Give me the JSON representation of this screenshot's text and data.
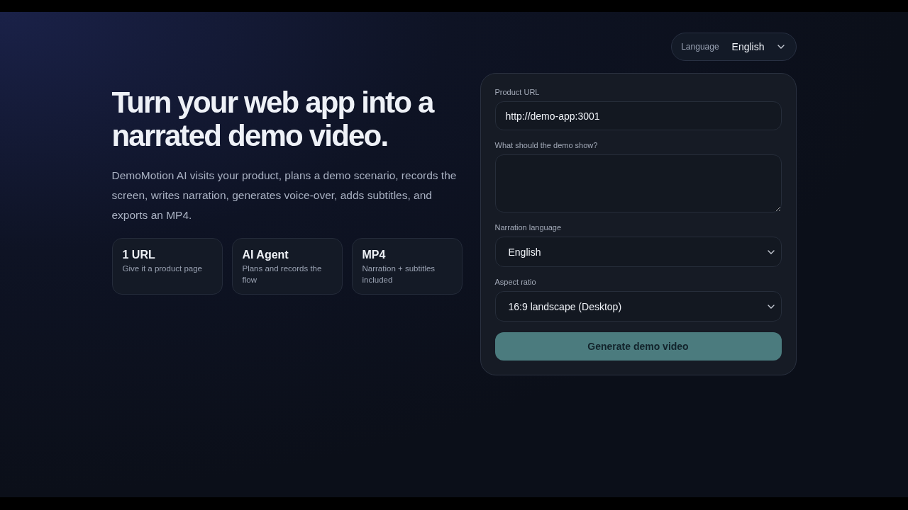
{
  "language_switcher": {
    "label": "Language",
    "value": "English"
  },
  "hero": {
    "title": "Turn your web app into a narrated demo video.",
    "description": "DemoMotion AI visits your product, plans a demo scenario, records the screen, writes narration, generates voice-over, adds subtitles, and exports an MP4."
  },
  "features": [
    {
      "title": "1 URL",
      "text": "Give it a product page"
    },
    {
      "title": "AI Agent",
      "text": "Plans and records the flow"
    },
    {
      "title": "MP4",
      "text": "Narration + subtitles included"
    }
  ],
  "form": {
    "fields": [
      {
        "kind": "input",
        "label": "Product URL",
        "value": "http://demo-app:3001"
      },
      {
        "kind": "textarea",
        "label": "What should the demo show?"
      },
      {
        "kind": "select",
        "label": "Narration language",
        "value": "English"
      },
      {
        "kind": "select",
        "label": "Aspect ratio",
        "value": "16:9 landscape (Desktop)"
      }
    ],
    "submit": {
      "label": "Generate demo video",
      "disabled": true
    }
  }
}
